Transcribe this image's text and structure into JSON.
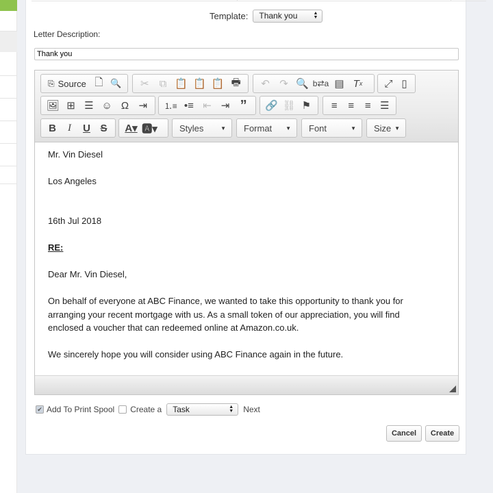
{
  "template": {
    "label": "Template:",
    "selected": "Thank you"
  },
  "description": {
    "label": "Letter Description:",
    "value": "Thank you"
  },
  "toolbar": {
    "source_label": "Source",
    "styles_label": "Styles",
    "format_label": "Format",
    "font_label": "Font",
    "size_label": "Size"
  },
  "letter": {
    "name": "Mr. Vin Diesel",
    "city": "Los Angeles",
    "date": "16th Jul 2018",
    "re": "RE:",
    "salutation": "Dear Mr. Vin Diesel,",
    "body1": "On behalf of everyone at ABC Finance, we wanted to take this opportunity to thank you for arranging your recent mortgage with us. As a small token of our appreciation, you will find enclosed a voucher that can redeemed online at Amazon.co.uk.",
    "body2": "We sincerely hope you will consider using ABC Finance again in the future."
  },
  "options": {
    "print_spool_label": "Add To Print Spool",
    "print_spool_checked": true,
    "create_label": "Create a",
    "create_checked": false,
    "create_type": "Task",
    "next_label": "Next"
  },
  "buttons": {
    "cancel": "Cancel",
    "create": "Create"
  },
  "colors": {
    "sidebar_accent": "#8ec34d",
    "page_background": "#eef0f4"
  }
}
